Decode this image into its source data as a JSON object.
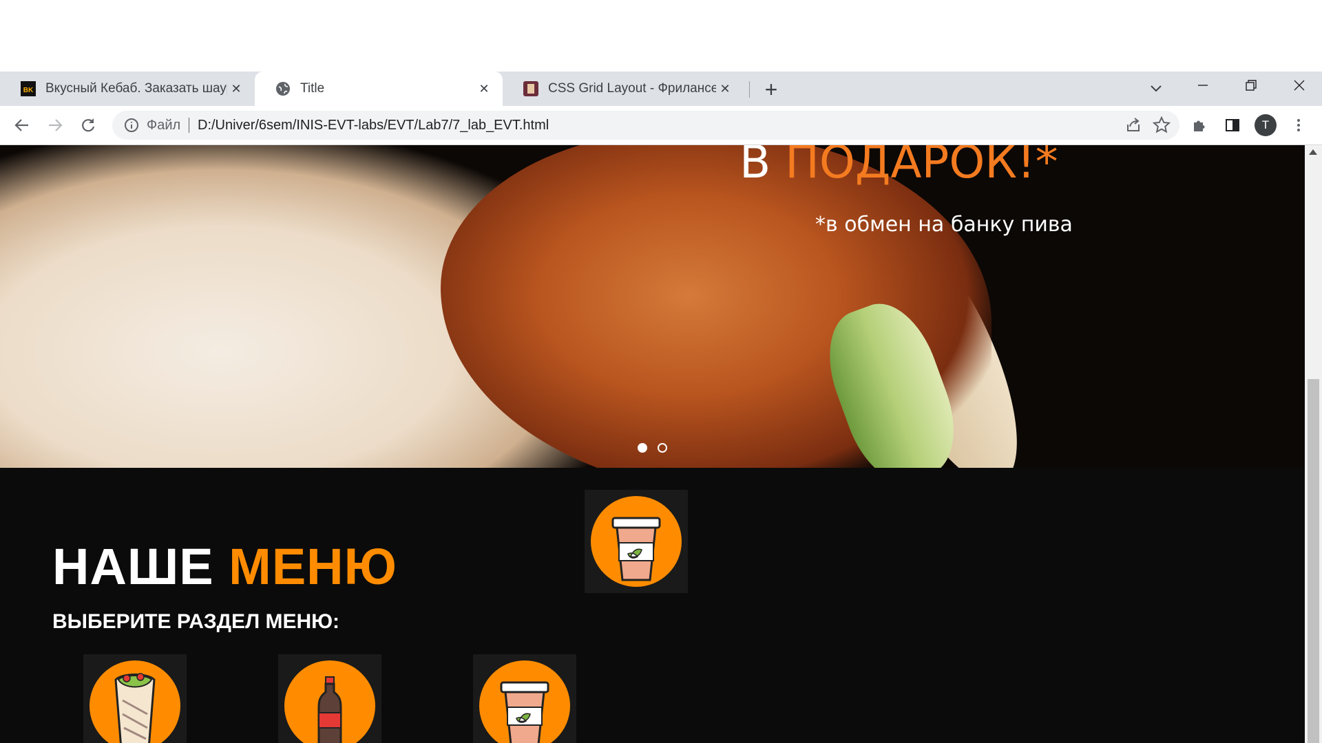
{
  "browser": {
    "tabs": [
      {
        "title": "Вкусный Кебаб. Заказать шаурма",
        "favicon": "vk-logo-icon",
        "active": false
      },
      {
        "title": "Title",
        "favicon": "globe-icon",
        "active": true
      },
      {
        "title": "CSS Grid Layout - Фрилансер по",
        "favicon": "site-icon",
        "active": false
      }
    ],
    "new_tab_symbol": "+",
    "favicon_vk_text": "BK",
    "address": {
      "scheme_label": "Файл",
      "url": "D:/Univer/6sem/INIS-EVT-labs/EVT/Lab7/7_lab_EVT.html"
    },
    "profile_initial": "T"
  },
  "page": {
    "banner": {
      "title_prefix": "В",
      "title_accent": "ПОДАРОК!*",
      "note": "*в обмен на банку пива",
      "slides": 2,
      "active_slide": 1
    },
    "menu": {
      "heading_white": "НАШЕ",
      "heading_accent": "МЕНЮ",
      "subheading": "ВЫБЕРИТЕ РАЗДЕЛ МЕНЮ:",
      "categories": [
        {
          "icon": "shawarma-icon"
        },
        {
          "icon": "soda-bottle-icon"
        },
        {
          "icon": "coffee-cup-icon"
        }
      ],
      "floating_icon": "coffee-cup-icon"
    },
    "colors": {
      "accent": "#ff8c00",
      "banner_accent": "#f47b20",
      "background": "#0b0b0b",
      "tile_bg": "#1a1a1a"
    }
  }
}
